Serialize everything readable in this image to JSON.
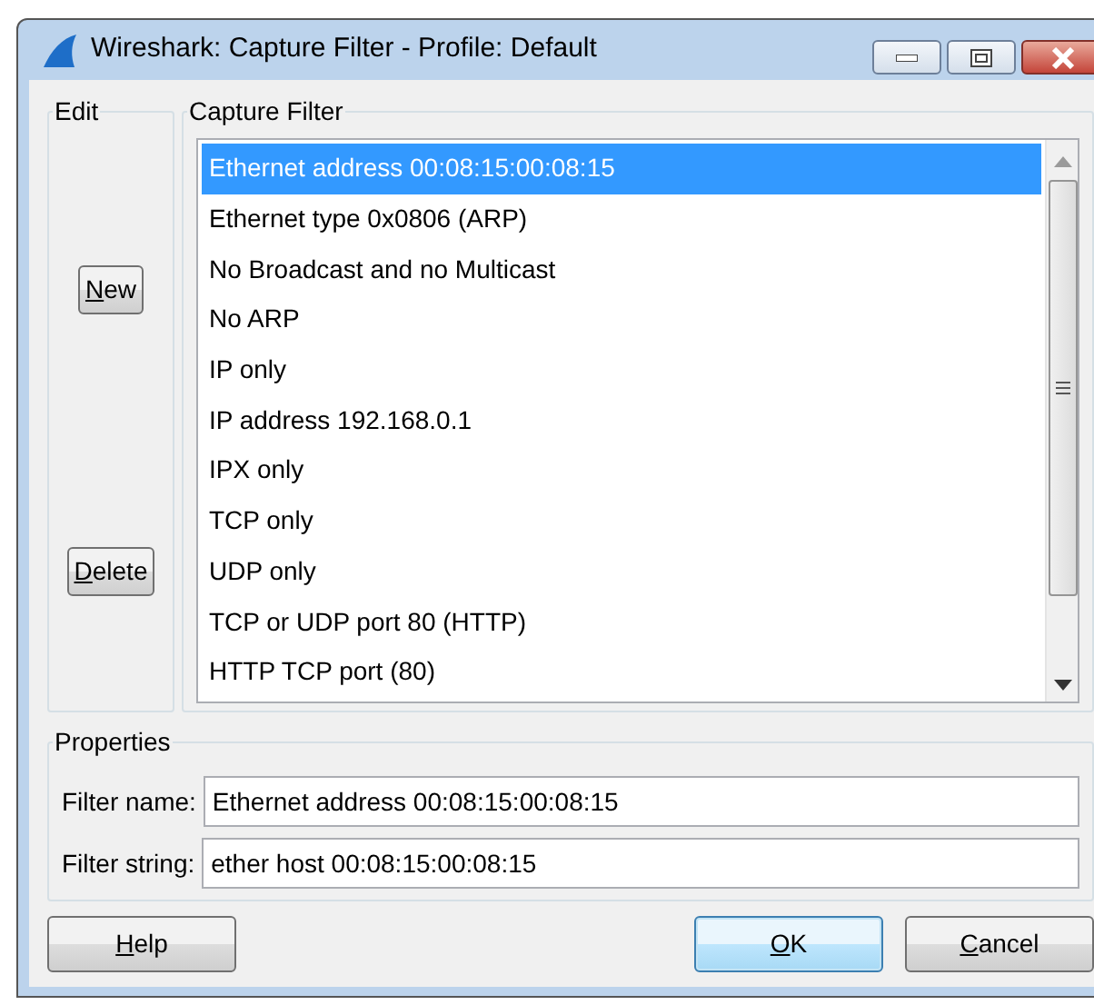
{
  "window": {
    "title": "Wireshark: Capture Filter - Profile: Default"
  },
  "edit_group": {
    "title": "Edit",
    "buttons": [
      {
        "mnemonic": "N",
        "rest": "ew"
      },
      {
        "mnemonic": "D",
        "rest": "elete"
      }
    ]
  },
  "capture_filter_group": {
    "title": "Capture Filter",
    "items": [
      {
        "label": "Ethernet address 00:08:15:00:08:15",
        "selected": true
      },
      {
        "label": "Ethernet type 0x0806 (ARP)",
        "selected": false
      },
      {
        "label": "No Broadcast and no Multicast",
        "selected": false
      },
      {
        "label": "No ARP",
        "selected": false
      },
      {
        "label": "IP only",
        "selected": false
      },
      {
        "label": "IP address 192.168.0.1",
        "selected": false
      },
      {
        "label": "IPX only",
        "selected": false
      },
      {
        "label": "TCP only",
        "selected": false
      },
      {
        "label": "UDP only",
        "selected": false
      },
      {
        "label": "TCP or UDP port 80 (HTTP)",
        "selected": false
      },
      {
        "label": "HTTP TCP port (80)",
        "selected": false
      }
    ]
  },
  "properties": {
    "title": "Properties",
    "fields": [
      {
        "label": "Filter name:",
        "value": "Ethernet address 00:08:15:00:08:15"
      },
      {
        "label": "Filter string:",
        "value": "ether host 00:08:15:00:08:15"
      }
    ]
  },
  "buttons": [
    {
      "mnemonic": "H",
      "rest": "elp",
      "default": false
    },
    {
      "mnemonic": "O",
      "rest": "K",
      "default": true
    },
    {
      "mnemonic": "C",
      "rest": "ancel",
      "default": false
    }
  ]
}
